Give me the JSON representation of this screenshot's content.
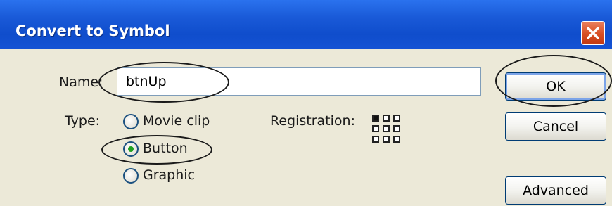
{
  "window": {
    "title": "Convert to Symbol"
  },
  "name": {
    "label": "Name:",
    "value": "btnUp"
  },
  "type": {
    "label": "Type:",
    "options": [
      {
        "label": "Movie clip",
        "selected": false
      },
      {
        "label": "Button",
        "selected": true
      },
      {
        "label": "Graphic",
        "selected": false
      }
    ]
  },
  "registration": {
    "label": "Registration:",
    "selected_point": "top-left"
  },
  "buttons": {
    "ok": "OK",
    "cancel": "Cancel",
    "advanced": "Advanced"
  },
  "colors": {
    "titlebar": "#1a5ad8",
    "dialog_bg": "#ece9d8",
    "close_button": "#d84d22",
    "radio_selected": "#21a121"
  },
  "icons": {
    "close": "close-icon",
    "registration": "registration-grid-icon"
  }
}
